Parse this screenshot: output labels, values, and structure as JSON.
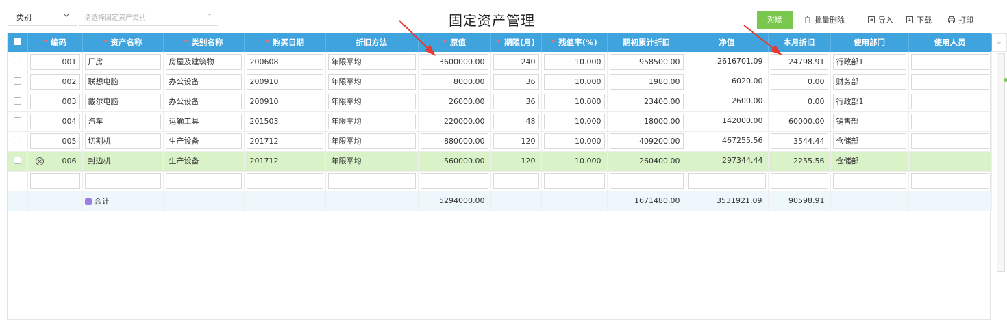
{
  "toolbar": {
    "filter_label": "类别",
    "category_select_placeholder": "请选择固定资产类别",
    "title": "固定资产管理",
    "reconcile_button": "对账",
    "batch_delete": "批量删除",
    "import": "导入",
    "download": "下载",
    "print": "打印"
  },
  "table": {
    "columns": [
      "编码",
      "资产名称",
      "类别名称",
      "购买日期",
      "折旧方法",
      "原值",
      "期限(月)",
      "残值率(%)",
      "期初累计折旧",
      "净值",
      "本月折旧",
      "使用部门",
      "使用人员"
    ],
    "required_columns": [
      "编码",
      "资产名称",
      "类别名称",
      "购买日期",
      "原值",
      "期限(月)",
      "残值率(%)"
    ],
    "rows": [
      {
        "code": "001",
        "name": "厂房",
        "category": "房屋及建筑物",
        "date": "200608",
        "method": "年限平均",
        "original": "3600000.00",
        "term": "240",
        "residual": "10.000",
        "opening_dep": "958500.00",
        "net": "2616701.09",
        "monthly_dep": "24798.91",
        "dept": "行政部1",
        "user": ""
      },
      {
        "code": "002",
        "name": "联想电脑",
        "category": "办公设备",
        "date": "200910",
        "method": "年限平均",
        "original": "8000.00",
        "term": "36",
        "residual": "10.000",
        "opening_dep": "1980.00",
        "net": "6020.00",
        "monthly_dep": "0.00",
        "dept": "财务部",
        "user": ""
      },
      {
        "code": "003",
        "name": "戴尔电脑",
        "category": "办公设备",
        "date": "200910",
        "method": "年限平均",
        "original": "26000.00",
        "term": "36",
        "residual": "10.000",
        "opening_dep": "23400.00",
        "net": "2600.00",
        "monthly_dep": "0.00",
        "dept": "行政部1",
        "user": ""
      },
      {
        "code": "004",
        "name": "汽车",
        "category": "运输工具",
        "date": "201503",
        "method": "年限平均",
        "original": "220000.00",
        "term": "48",
        "residual": "10.000",
        "opening_dep": "18000.00",
        "net": "142000.00",
        "monthly_dep": "60000.00",
        "dept": "销售部",
        "user": ""
      },
      {
        "code": "005",
        "name": "切割机",
        "category": "生产设备",
        "date": "201712",
        "method": "年限平均",
        "original": "880000.00",
        "term": "120",
        "residual": "10.000",
        "opening_dep": "409200.00",
        "net": "467255.56",
        "monthly_dep": "3544.44",
        "dept": "仓储部",
        "user": ""
      },
      {
        "code": "006",
        "name": "封边机",
        "category": "生产设备",
        "date": "201712",
        "method": "年限平均",
        "original": "560000.00",
        "term": "120",
        "residual": "10.000",
        "opening_dep": "260400.00",
        "net": "297344.44",
        "monthly_dep": "2255.56",
        "dept": "仓储部",
        "user": ""
      }
    ],
    "selected_row": 5,
    "total": {
      "label": "合计",
      "original": "5294000.00",
      "opening_dep": "1671480.00",
      "net": "3531921.09",
      "monthly_dep": "90598.91"
    }
  },
  "colors": {
    "header": "#3fa3dd",
    "accent_green": "#7ac74f",
    "selected_row": "#d9f2c8",
    "required_star": "#f56c6c",
    "annotation_arrow": "#e8382f"
  }
}
